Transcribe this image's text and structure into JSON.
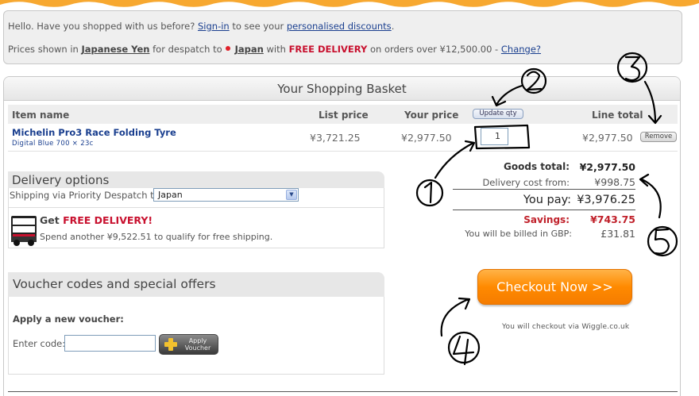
{
  "info": {
    "hello": "Hello. Have you shopped with us before?",
    "signin": "Sign-in",
    "to_see": "to see your",
    "personalised": "personalised discounts",
    "period": ".",
    "prices_shown": "Prices shown in",
    "currency": "Japanese Yen",
    "for_despatch": "for despatch to",
    "country": "Japan",
    "with": "with",
    "free_delivery": "FREE DELIVERY",
    "threshold": "on orders over ¥12,500.00 -",
    "change": "Change?"
  },
  "basket": {
    "title": "Your Shopping Basket",
    "columns": {
      "item_name": "Item name",
      "list_price": "List price",
      "your_price": "Your price",
      "update_qty": "Update qty",
      "line_total": "Line total"
    },
    "items": [
      {
        "name": "Michelin Pro3 Race Folding Tyre",
        "variant": "Digital Blue 700 × 23c",
        "list_price": "¥3,721.25",
        "your_price": "¥2,977.50",
        "qty": "1",
        "line_total": "¥2,977.50",
        "remove": "Remove"
      }
    ]
  },
  "delivery": {
    "heading": "Delivery options",
    "shipping_via": "Shipping via Priority Despatch to",
    "selected_country": "Japan",
    "get": "Get",
    "free_delivery": "FREE DELIVERY!",
    "spend": "Spend another ¥9,522.51 to qualify for free shipping.",
    "truck_label": "FREE DELIVERY"
  },
  "voucher": {
    "heading": "Voucher codes and special offers",
    "apply_new": "Apply a new voucher:",
    "enter_code": "Enter code:",
    "code_value": "",
    "apply_line1": "Apply",
    "apply_line2": "Voucher"
  },
  "totals": {
    "goods_label": "Goods total:",
    "goods_value": "¥2,977.50",
    "delivery_label": "Delivery cost from:",
    "delivery_value": "¥998.75",
    "pay_label": "You pay:",
    "pay_value": "¥3,976.25",
    "savings_label": "Savings:",
    "savings_value": "¥743.75",
    "billed_label": "You will be billed in GBP:",
    "billed_value": "£31.81"
  },
  "checkout": {
    "label": "Checkout Now >>",
    "note": "You will checkout via Wiggle.co.uk"
  },
  "colors": {
    "brand_orange": "#ff8a00",
    "link_blue": "#1a3f8f",
    "free_red": "#c8102e",
    "savings_red": "#c0202a"
  }
}
